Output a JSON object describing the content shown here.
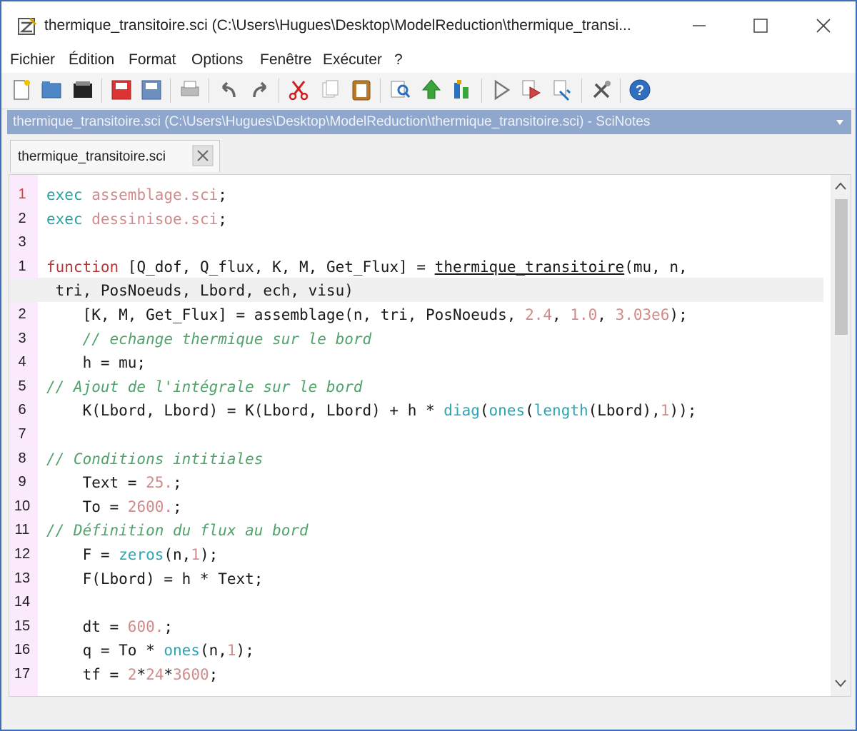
{
  "window": {
    "title": "thermique_transitoire.sci (C:\\Users\\Hugues\\Desktop\\ModelReduction\\thermique_transi...",
    "minimize_label": "–",
    "maximize_label": "□",
    "close_label": "✕"
  },
  "menu": {
    "items": [
      "Fichier",
      "Édition",
      "Format",
      "Options",
      "Fenêtre",
      "Exécuter",
      "?"
    ]
  },
  "toolbar": {
    "icons": [
      "new-file-icon",
      "open-file-icon",
      "open-folder-icon",
      "save-icon",
      "save-as-icon",
      "print-icon",
      "undo-icon",
      "redo-icon",
      "cut-icon",
      "copy-icon",
      "paste-icon",
      "find-icon",
      "load-into-scilab-icon",
      "execute-icon",
      "run-icon",
      "run-file-icon",
      "debug-icon",
      "settings-icon",
      "help-icon"
    ]
  },
  "pathbar": {
    "text": "thermique_transitoire.sci (C:\\Users\\Hugues\\Desktop\\ModelReduction\\thermique_transitoire.sci) - SciNotes"
  },
  "tab": {
    "label": "thermique_transitoire.sci"
  },
  "colors": {
    "accent": "#3c6fb5",
    "path_bar": "#8fa7cc",
    "gutter": "#fbeafb",
    "keyword": "#26a3a3",
    "comment": "#4fa36a",
    "string": "#d18b8b",
    "function_kw": "#b03a3a"
  },
  "editor": {
    "lines": [
      {
        "num": "1",
        "red": true,
        "text": "exec assemblage.sci;"
      },
      {
        "num": "2",
        "text": "exec dessinisoe.sci;"
      },
      {
        "num": "3",
        "text": ""
      },
      {
        "num": "1",
        "text": "function [Q_dof, Q_flux, K, M, Get_Flux] = thermique_transitoire(mu, n,"
      },
      {
        "num": "",
        "wrap": true,
        "text": " tri, PosNoeuds, Lbord, ech, visu)"
      },
      {
        "num": "2",
        "text": "    [K, M, Get_Flux] = assemblage(n, tri, PosNoeuds, 2.4, 1.0, 3.03e6);"
      },
      {
        "num": "3",
        "text": "    // echange thermique sur le bord"
      },
      {
        "num": "4",
        "text": "    h = mu;"
      },
      {
        "num": "5",
        "text": "// Ajout de l'intégrale sur le bord"
      },
      {
        "num": "6",
        "text": "    K(Lbord, Lbord) = K(Lbord, Lbord) + h * diag(ones(length(Lbord),1));"
      },
      {
        "num": "7",
        "text": ""
      },
      {
        "num": "8",
        "text": "// Conditions intitiales"
      },
      {
        "num": "9",
        "text": "    Text = 25.;"
      },
      {
        "num": "10",
        "text": "    To = 2600.;"
      },
      {
        "num": "11",
        "text": "// Définition du flux au bord"
      },
      {
        "num": "12",
        "text": "    F = zeros(n,1);"
      },
      {
        "num": "13",
        "text": "    F(Lbord) = h * Text;"
      },
      {
        "num": "14",
        "text": ""
      },
      {
        "num": "15",
        "text": "    dt = 600.;"
      },
      {
        "num": "16",
        "text": "    q = To * ones(n,1);"
      },
      {
        "num": "17",
        "text": "    tf = 2*24*3600;"
      }
    ]
  }
}
